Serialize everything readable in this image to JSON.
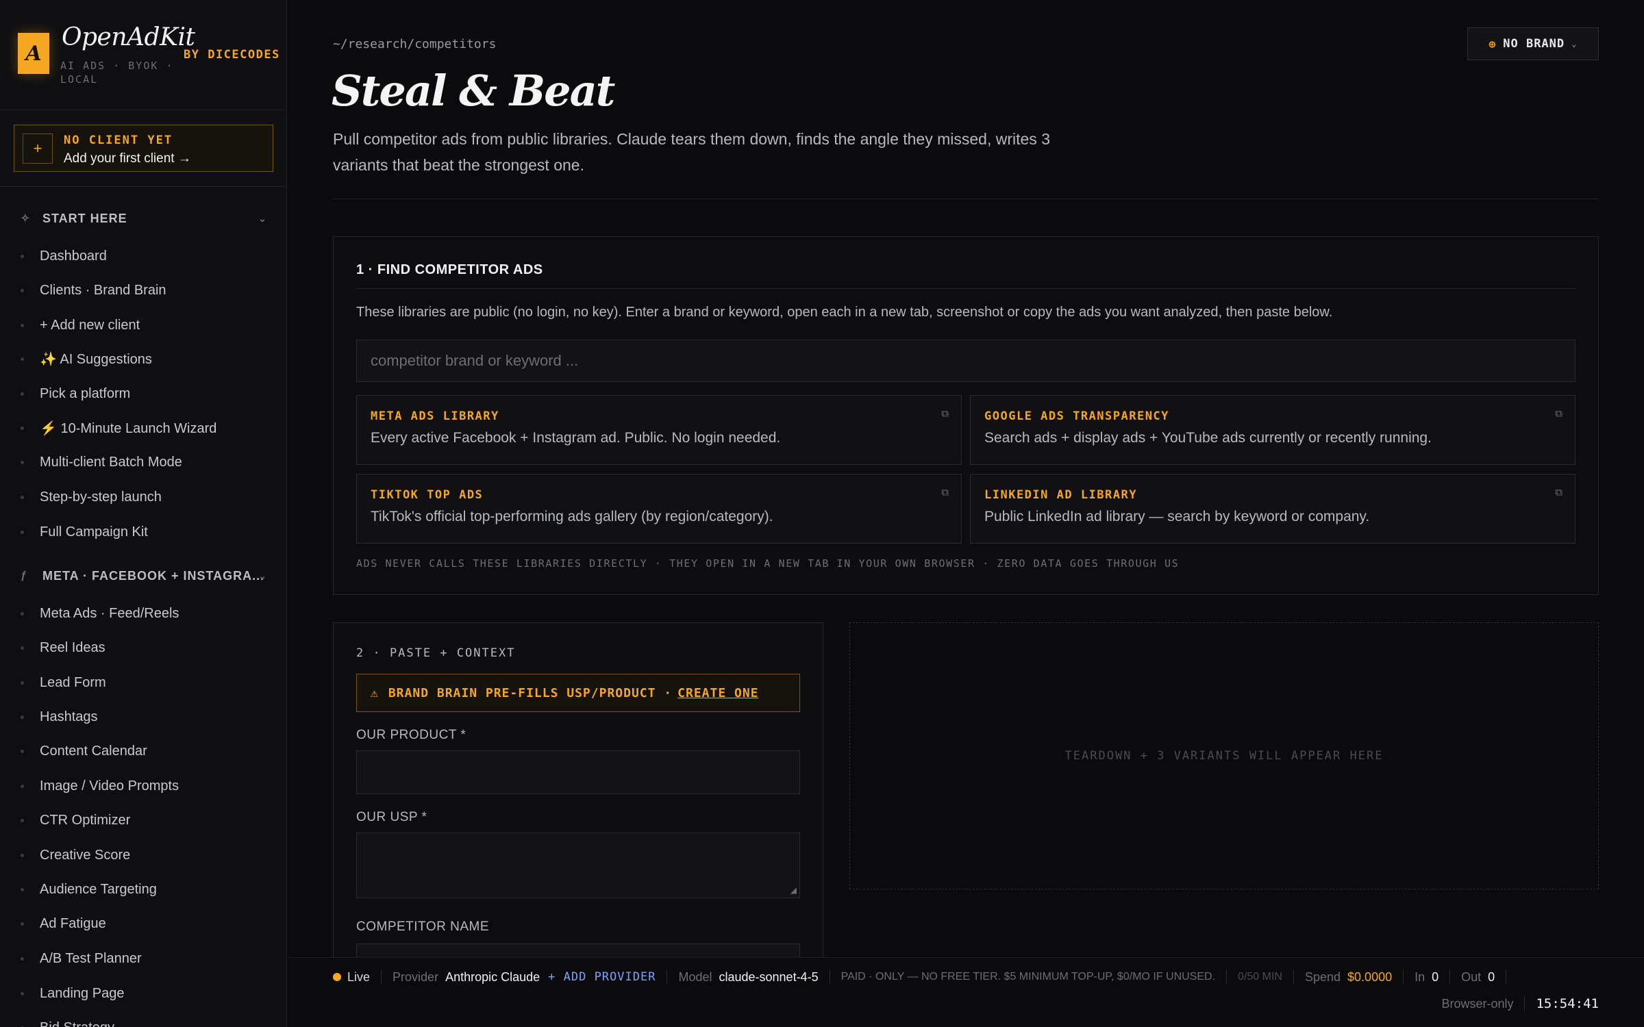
{
  "app": {
    "logo_letter": "A",
    "name": "OpenAdKit",
    "tagline": "AI ADS · BYOK · LOCAL",
    "by": "BY DICECODES"
  },
  "client": {
    "title": "NO CLIENT YET",
    "action": "Add your first client →",
    "plus": "+"
  },
  "sidebar": {
    "sections": [
      {
        "label": "START HERE",
        "icon": "sparkle-icon",
        "items": [
          "Dashboard",
          "Clients · Brand Brain",
          "+ Add new client",
          "✨ AI Suggestions",
          "Pick a platform",
          "⚡ 10-Minute Launch Wizard",
          "Multi-client Batch Mode",
          "Step-by-step launch",
          "Full Campaign Kit"
        ]
      },
      {
        "label": "META · FACEBOOK + INSTAGRA...",
        "icon": "meta-icon",
        "items": [
          "Meta Ads · Feed/Reels",
          "Reel Ideas",
          "Lead Form",
          "Hashtags",
          "Content Calendar",
          "Image / Video Prompts",
          "CTR Optimizer",
          "Creative Score",
          "Audience Targeting",
          "Ad Fatigue",
          "A/B Test Planner",
          "Landing Page",
          "Bid Strategy"
        ]
      }
    ]
  },
  "header": {
    "path": "~/research/competitors",
    "title": "Steal & Beat",
    "description": "Pull competitor ads from public libraries. Claude tears them down, finds the angle they missed, writes 3 variants that beat the strongest one.",
    "brand_button": "NO BRAND"
  },
  "find": {
    "title": "1 · FIND COMPETITOR ADS",
    "description": "These libraries are public (no login, no key). Enter a brand or keyword, open each in a new tab, screenshot or copy the ads you want analyzed, then paste below.",
    "search_placeholder": "competitor brand or keyword ...",
    "libraries": [
      {
        "name": "META ADS LIBRARY",
        "desc": "Every active Facebook + Instagram ad. Public. No login needed."
      },
      {
        "name": "GOOGLE ADS TRANSPARENCY",
        "desc": "Search ads + display ads + YouTube ads currently or recently running."
      },
      {
        "name": "TIKTOK TOP ADS",
        "desc": "TikTok's official top-performing ads gallery (by region/category)."
      },
      {
        "name": "LINKEDIN AD LIBRARY",
        "desc": "Public LinkedIn ad library — search by keyword or company."
      }
    ],
    "note": "ADS NEVER CALLS THESE LIBRARIES DIRECTLY · THEY OPEN IN A NEW TAB IN YOUR OWN BROWSER · ZERO DATA GOES THROUGH US"
  },
  "paste": {
    "title": "2 · PASTE + CONTEXT",
    "warning": "BRAND BRAIN PRE-FILLS USP/PRODUCT ·",
    "warning_link": "CREATE ONE",
    "product_label": "OUR PRODUCT *",
    "usp_label": "OUR USP *",
    "competitor_label": "COMPETITOR NAME"
  },
  "output": {
    "placeholder": "TEARDOWN + 3 VARIANTS WILL APPEAR HERE"
  },
  "status": {
    "live": "Live",
    "provider_label": "Provider",
    "provider": "Anthropic Claude",
    "add_provider": "+ ADD PROVIDER",
    "model_label": "Model",
    "model": "claude-sonnet-4-5",
    "paid_note": "PAID · ONLY — NO FREE TIER. $5 MINIMUM TOP-UP, $0/MO IF UNUSED.",
    "minutes": "0/50 MIN",
    "spend_label": "Spend",
    "spend": "$0.0000",
    "in_label": "In",
    "in": "0",
    "out_label": "Out",
    "out": "0",
    "browser": "Browser-only",
    "time": "15:54:41"
  },
  "colors": {
    "accent": "#f5a623",
    "background": "#0b0b0d",
    "link_blue": "#7aa2ff"
  }
}
